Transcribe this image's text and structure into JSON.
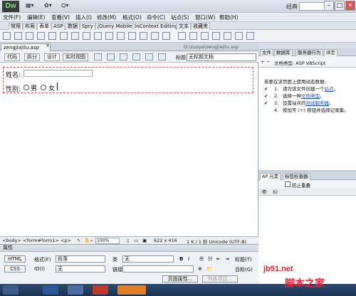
{
  "app": {
    "logo": "Dw",
    "workspace": "经典"
  },
  "menu": [
    "文件(F)",
    "编辑(E)",
    "查看(V)",
    "插入(I)",
    "修改(M)",
    "格式(O)",
    "命令(C)",
    "站点(S)",
    "窗口(W)",
    "帮助(H)"
  ],
  "insert_tabs": [
    "常用",
    "布局",
    "表单",
    "ASP",
    "数据",
    "Spry",
    "jQuery Mobile",
    "InContext Editing",
    "文本",
    "收藏夹"
  ],
  "active_insert_tab": "表单",
  "document": {
    "tab_name": "zengjiajilu.asp",
    "path": "G:\\zuoye\\zengjiajilu.asp",
    "view_buttons": [
      "代码",
      "拆分",
      "设计",
      "实时视图"
    ],
    "title_label": "标题:",
    "title_value": "无标题文档"
  },
  "form": {
    "name_label": "姓名:",
    "sex_label": "性别:",
    "option_male": "男",
    "option_female": "女"
  },
  "status": {
    "tag_path": "<body> <form#form1> <p>",
    "zoom": "100%",
    "size": "622 x 416",
    "download": "1 K / 1 秒 Unicode (UTF-8)"
  },
  "properties": {
    "header": "属性",
    "html_btn": "HTML",
    "css_btn": "CSS",
    "format_label": "格式(F)",
    "format_value": "段落",
    "class_label": "类",
    "class_value": "无",
    "id_label": "ID(I)",
    "id_value": "无",
    "link_label": "链接(L)",
    "bold": "B",
    "italic": "I",
    "title_label": "标题(T)",
    "target_label": "目标(G)",
    "page_props": "页面属性...",
    "list_item": "列表项目..."
  },
  "right_panel": {
    "tabs": [
      "文件",
      "数据库",
      "服务器行为",
      "绑定"
    ],
    "active_tab": "绑定",
    "doc_type_label": "文档类型: ASP VBScript",
    "intro": "若要在该页面上使用动态数据:",
    "steps": [
      {
        "num": "1.",
        "text": "请为该文件创建一个",
        "link": "站点",
        "suffix": "。"
      },
      {
        "num": "2.",
        "text": "选择一种",
        "link": "文档类型",
        "suffix": "。"
      },
      {
        "num": "3.",
        "text": "设置站点的",
        "link": "测试服务器",
        "suffix": "。"
      },
      {
        "num": "4.",
        "text": "按加号 (+) 按钮并选择记录集。",
        "link": "",
        "suffix": ""
      }
    ]
  },
  "ap_panel": {
    "tabs": [
      "AP 元素",
      "标签检查器"
    ],
    "active_tab": "AP 元素",
    "prevent_overlap": "防止重叠",
    "col_id": "ID"
  },
  "watermark": {
    "line1": "jb51.net",
    "line2": "脚本之家"
  }
}
